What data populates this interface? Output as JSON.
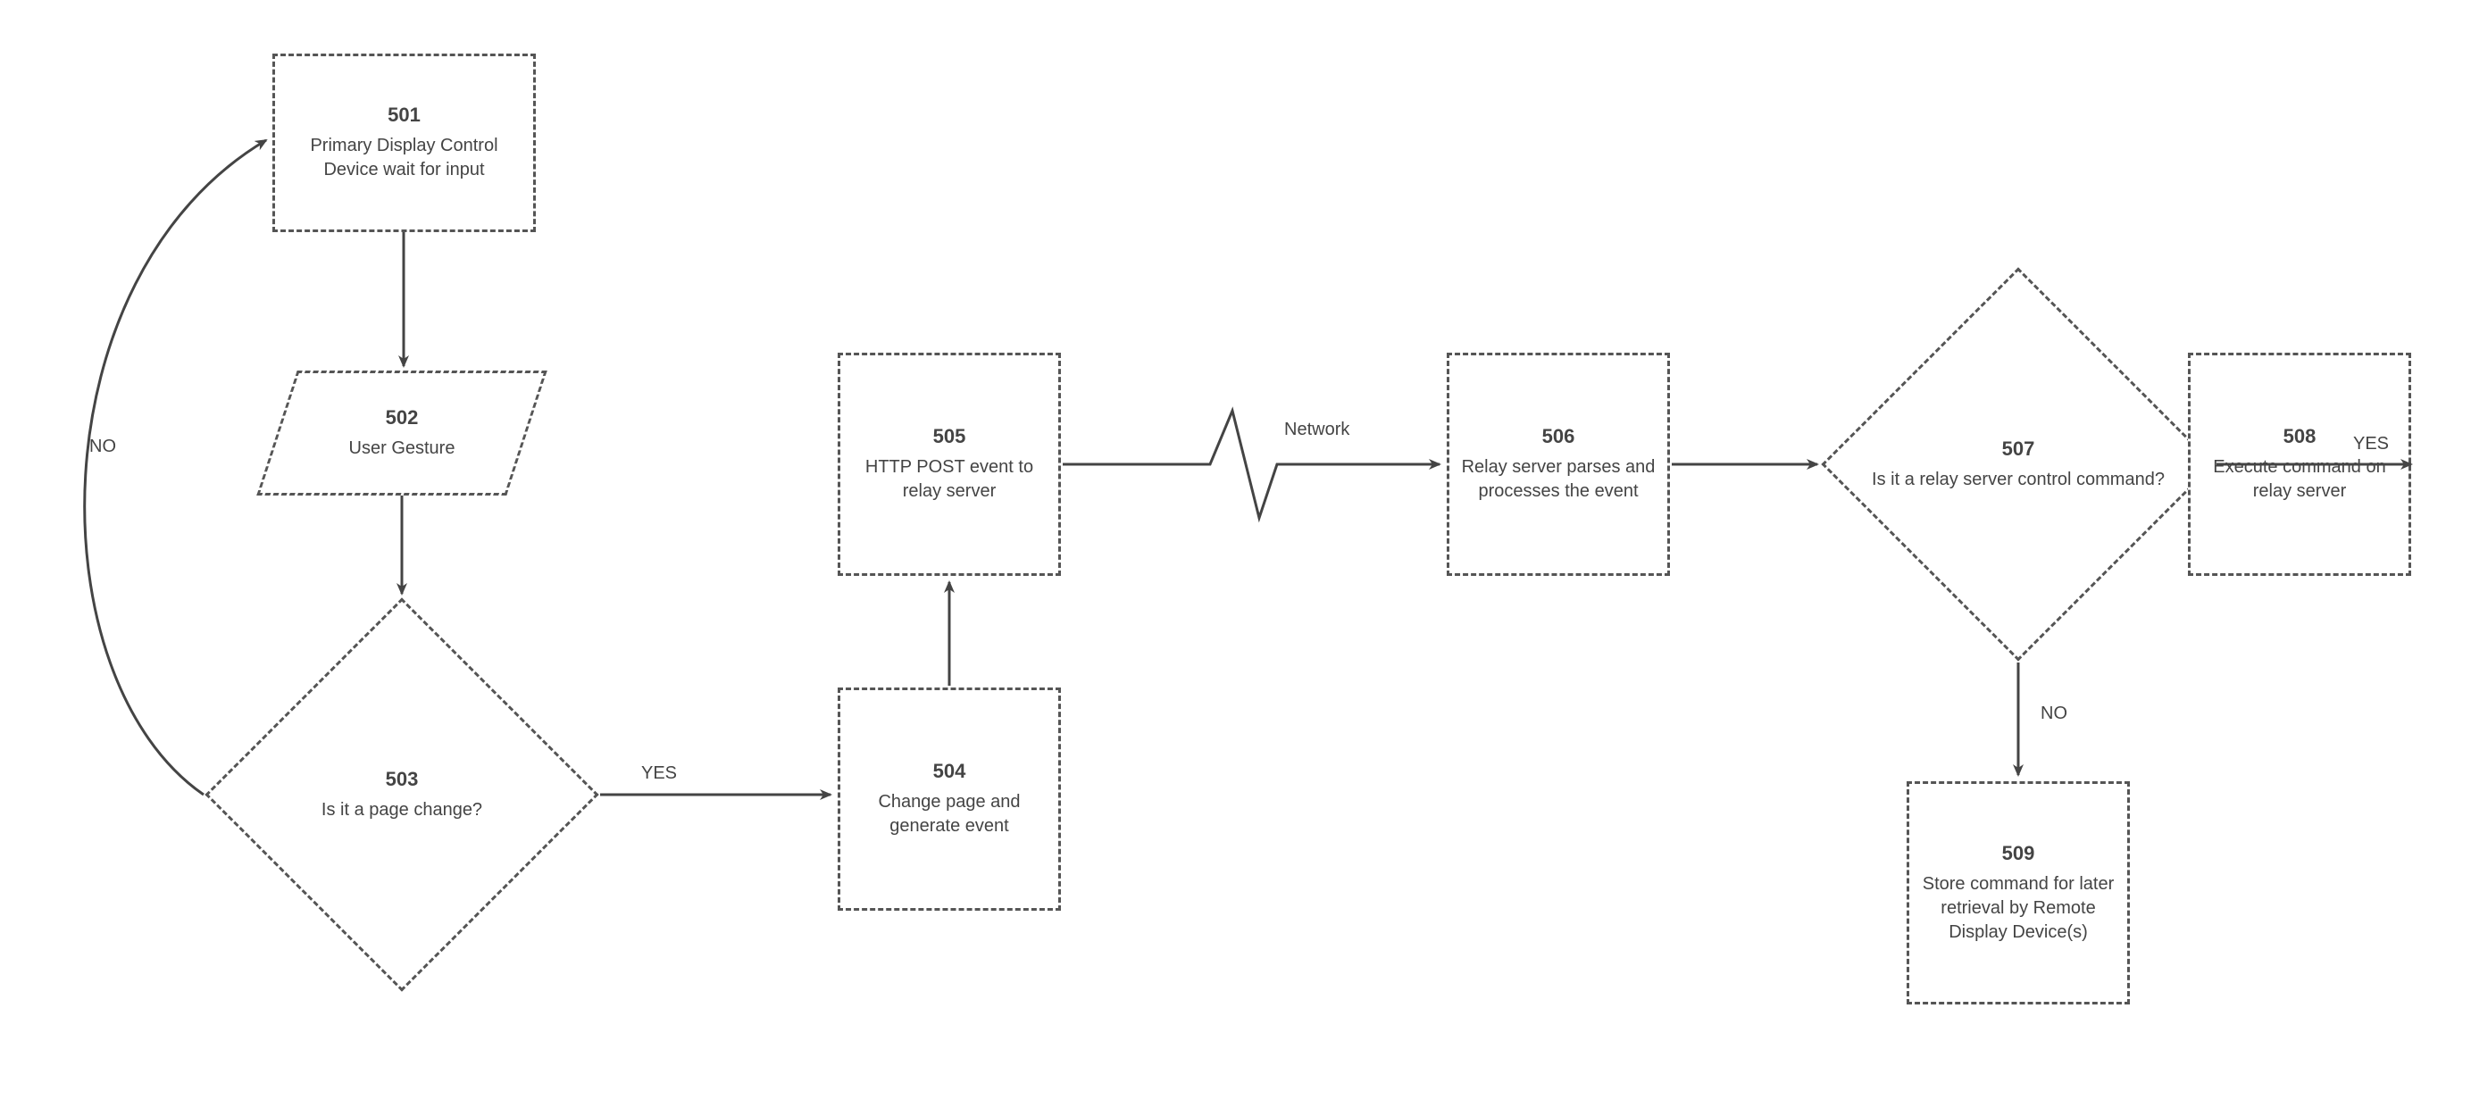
{
  "nodes": {
    "n501": {
      "num": "501",
      "txt": "Primary Display Control Device wait for input"
    },
    "n502": {
      "num": "502",
      "txt": "User Gesture"
    },
    "n503": {
      "num": "503",
      "txt": "Is it a page change?"
    },
    "n504": {
      "num": "504",
      "txt": "Change page and generate event"
    },
    "n505": {
      "num": "505",
      "txt": "HTTP POST event to relay server"
    },
    "n506": {
      "num": "506",
      "txt": "Relay server parses and processes the event"
    },
    "n507": {
      "num": "507",
      "txt": "Is it a relay server control command?"
    },
    "n508": {
      "num": "508",
      "txt": "Execute command on relay server"
    },
    "n509": {
      "num": "509",
      "txt": "Store command for later retrieval by Remote Display Device(s)"
    }
  },
  "labels": {
    "no503": "NO",
    "yes503": "YES",
    "network": "Network",
    "yes507": "YES",
    "no507": "NO"
  }
}
